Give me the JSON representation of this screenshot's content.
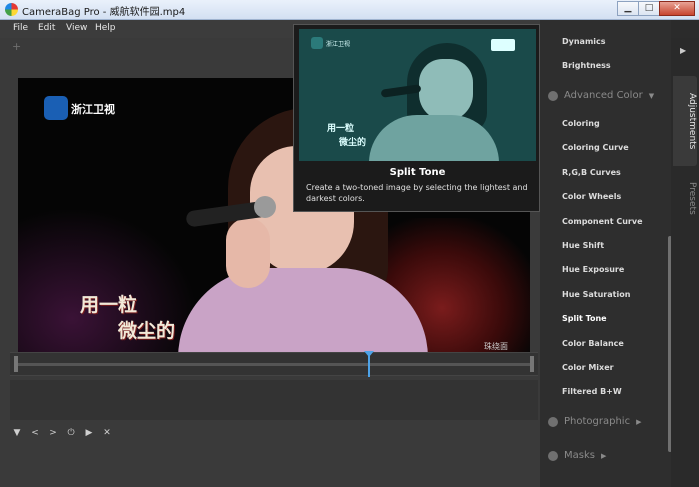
{
  "window": {
    "title": "CameraBag Pro - 威航软件园.mp4",
    "minimize_label": "▁",
    "maximize_label": "□",
    "close_label": "✕"
  },
  "menu": {
    "items": [
      "File",
      "Edit",
      "View",
      "Help"
    ]
  },
  "workspace": {
    "add_symbol": "+",
    "video": {
      "channel_name": "浙江卫视",
      "lyric_line1": "用一粒",
      "lyric_line2": "微尘的",
      "watermark": "珠绕面"
    }
  },
  "playback_controls": [
    "▼",
    "<",
    ">",
    "⏻",
    "▶",
    "✕"
  ],
  "adjustments": {
    "basic_items": [
      "Dynamics",
      "Brightness"
    ],
    "sections": [
      {
        "label": "Advanced Color",
        "arrow": "▼"
      },
      {
        "label": "Photographic",
        "arrow": "▶"
      },
      {
        "label": "Masks",
        "arrow": "▶"
      }
    ],
    "advanced_items": [
      "Coloring",
      "Coloring Curve",
      "R,G,B Curves",
      "Color Wheels",
      "Component Curve",
      "Hue Shift",
      "Hue Exposure",
      "Hue Saturation",
      "Split Tone",
      "Color Balance",
      "Color Mixer",
      "Filtered B+W"
    ]
  },
  "side_tabs": {
    "collapse_arrow": "▶",
    "active": "Adjustments",
    "inactive": "Presets"
  },
  "tooltip": {
    "title": "Split Tone",
    "description": "Create a two-toned image by selecting the lightest and darkest colors.",
    "preview": {
      "channel_name": "浙江卫视",
      "lyric_line1": "用一粒",
      "lyric_line2": "微尘的"
    }
  }
}
